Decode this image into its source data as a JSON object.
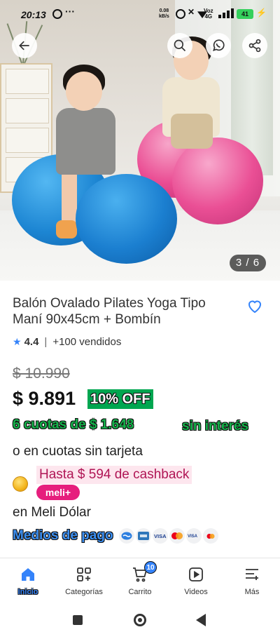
{
  "status_bar": {
    "time": "20:13",
    "dots": "···",
    "net_speed": "0.08",
    "net_unit": "kB/s",
    "volte": "Voz",
    "network": "4G",
    "battery": "41"
  },
  "gallery": {
    "counter": "3 / 6"
  },
  "product": {
    "title": "Balón Ovalado Pilates Yoga Tipo Maní 90x45cm + Bombín",
    "rating": "4.4",
    "separator": "|",
    "sold": "+100 vendidos",
    "old_price": "$ 10.990",
    "price": "$ 9.891",
    "discount": "10% OFF",
    "installments": "6 cuotas de $ 1.648",
    "interest": "sin interés",
    "no_card": "o en cuotas sin tarjeta",
    "cashback": "Hasta $ 594 de cashback",
    "meli_badge": "meli+",
    "meli_dolar": "en Meli Dólar",
    "payment_methods_label": "Medios de pago",
    "payment_icons": [
      "mercado-pago-icon",
      "amex-icon",
      "visa-icon",
      "mastercard-icon",
      "visa-debit-icon",
      "mastercard-debit-icon"
    ]
  },
  "nav": {
    "items": [
      {
        "label": "Inicio",
        "icon": "home-icon",
        "active": true
      },
      {
        "label": "Categorías",
        "icon": "grid-icon"
      },
      {
        "label": "Carrito",
        "icon": "cart-icon",
        "badge": "10"
      },
      {
        "label": "Videos",
        "icon": "play-icon"
      },
      {
        "label": "Más",
        "icon": "menu-icon"
      }
    ]
  },
  "colors": {
    "accent": "#3483fa",
    "discount_green": "#00a650",
    "cashback_pink": "#e61e7d"
  }
}
